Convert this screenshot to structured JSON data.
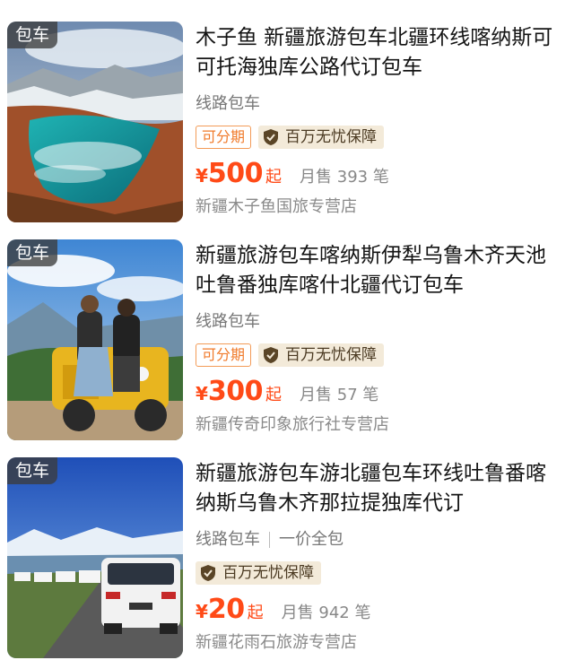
{
  "products": [
    {
      "tag": "包车",
      "title": "木子鱼 新疆旅游包车北疆环线喀纳斯可可托海独库公路代订包车",
      "subtitle": "线路包车",
      "subtitle_extra": "",
      "installment": "可分期",
      "guarantee": "百万无忧保障",
      "currency": "¥",
      "price": "500",
      "price_suffix": "起",
      "sold": "月售 393 笔",
      "shop": "新疆木子鱼国旅专营店",
      "image_icon": "lake-landscape-photo"
    },
    {
      "tag": "包车",
      "title": "新疆旅游包车喀纳斯伊犁乌鲁木齐天池吐鲁番独库喀什北疆代订包车",
      "subtitle": "线路包车",
      "subtitle_extra": "",
      "installment": "可分期",
      "guarantee": "百万无忧保障",
      "currency": "¥",
      "price": "300",
      "price_suffix": "起",
      "sold": "月售 57 笔",
      "shop": "新疆传奇印象旅行社专营店",
      "image_icon": "couple-on-jeep-photo"
    },
    {
      "tag": "包车",
      "title": "新疆旅游包车游北疆包车环线吐鲁番喀纳斯乌鲁木齐那拉提独库代订",
      "subtitle": "线路包车",
      "subtitle_extra": "一价全包",
      "installment": "",
      "guarantee": "百万无忧保障",
      "currency": "¥",
      "price": "20",
      "price_suffix": "起",
      "sold": "月售 942 笔",
      "shop": "新疆花雨石旅游专营店",
      "image_icon": "suv-convoy-road-photo"
    }
  ],
  "colors": {
    "price": "#ff4a17",
    "installment": "#f07a2a",
    "guarantee_bg": "#f3ead9"
  }
}
